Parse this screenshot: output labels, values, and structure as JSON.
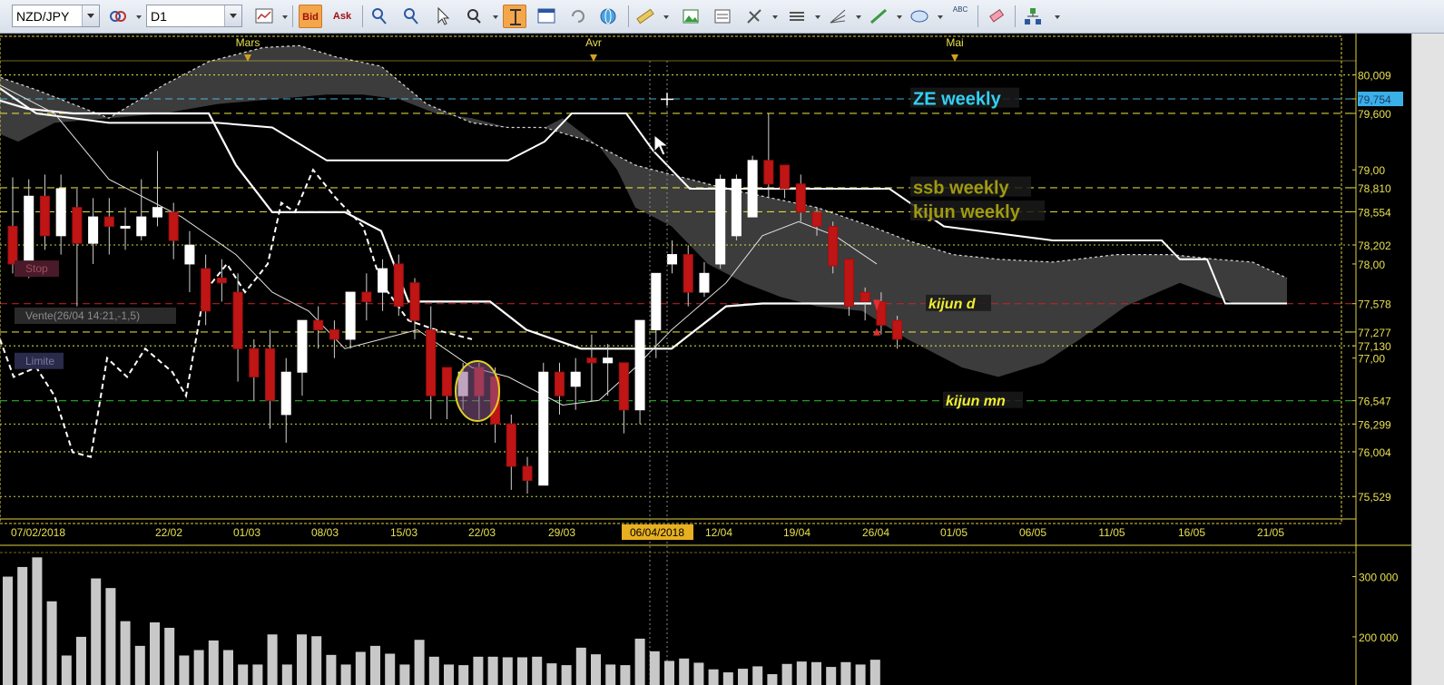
{
  "toolbar": {
    "symbol": "NZD/JPY",
    "timeframe": "D1",
    "bid_label": "Bid",
    "ask_label": "Ask",
    "abc_label": "ABC"
  },
  "chart_data": {
    "type": "candlestick",
    "instrument": "NZD/JPY",
    "timeframe": "D1",
    "months": [
      "Mars",
      "Avr",
      "Mai"
    ],
    "x_ticks": [
      "07/02/2018",
      "22/02",
      "01/03",
      "08/03",
      "15/03",
      "22/03",
      "29/03",
      "06/04/2018",
      "12/04",
      "19/04",
      "26/04",
      "01/05",
      "06/05",
      "11/05",
      "16/05",
      "21/05"
    ],
    "y_range": [
      75.3,
      80.4
    ],
    "y_ticks": [
      "80,009",
      "79,754",
      "79,600",
      "79,00",
      "78,810",
      "78,554",
      "78,202",
      "78,00",
      "77,578",
      "77,277",
      "77,130",
      "77,00",
      "76,547",
      "76,299",
      "76,004",
      "75,529"
    ],
    "level_lines": [
      {
        "value": 80.009,
        "color": "#e8e840",
        "style": "dotted"
      },
      {
        "value": 79.754,
        "color": "#4dc3f0",
        "style": "dashed"
      },
      {
        "value": 79.6,
        "color": "#e8e840",
        "style": "dashed"
      },
      {
        "value": 78.81,
        "color": "#e8e840",
        "style": "dashed"
      },
      {
        "value": 78.554,
        "color": "#e8e840",
        "style": "dashed"
      },
      {
        "value": 78.202,
        "color": "#e8e840",
        "style": "dotted"
      },
      {
        "value": 77.578,
        "color": "#cc2020",
        "style": "dashed"
      },
      {
        "value": 77.277,
        "color": "#e8e840",
        "style": "dashed"
      },
      {
        "value": 77.13,
        "color": "#e8e840",
        "style": "dotted"
      },
      {
        "value": 76.547,
        "color": "#30c030",
        "style": "dashed"
      },
      {
        "value": 76.299,
        "color": "#e8e840",
        "style": "dotted"
      },
      {
        "value": 76.004,
        "color": "#e8e840",
        "style": "dotted"
      },
      {
        "value": 75.529,
        "color": "#e8e840",
        "style": "dotted"
      }
    ],
    "annotations": [
      {
        "text": "ZE weekly",
        "color": "#33d0f5"
      },
      {
        "text": "ssb weekly",
        "color": "#a09a10"
      },
      {
        "text": "kijun weekly",
        "color": "#a09a10"
      },
      {
        "text": "kijun d",
        "color": "#f0ee30"
      },
      {
        "text": "kijun mn",
        "color": "#f0ee30"
      }
    ],
    "order_labels": [
      "Stop",
      "Vente(26/04 14:21,-1,5)",
      "Limite"
    ],
    "candles": [
      [
        78.4,
        78.0,
        78.92,
        77.9
      ],
      [
        78.0,
        78.72,
        78.9,
        77.85
      ],
      [
        78.72,
        78.3,
        78.95,
        78.15
      ],
      [
        78.3,
        78.8,
        78.95,
        78.1
      ],
      [
        78.6,
        78.22,
        78.8,
        77.55
      ],
      [
        78.22,
        78.5,
        78.7,
        78.0
      ],
      [
        78.5,
        78.4,
        78.7,
        78.1
      ],
      [
        78.4,
        78.4,
        78.6,
        78.15
      ],
      [
        78.3,
        78.5,
        78.9,
        78.25
      ],
      [
        78.5,
        78.6,
        79.2,
        78.4
      ],
      [
        78.55,
        78.25,
        78.65,
        78.05
      ],
      [
        78.0,
        78.2,
        78.35,
        77.7
      ],
      [
        77.95,
        77.5,
        78.1,
        77.35
      ],
      [
        77.85,
        77.8,
        78.05,
        77.6
      ],
      [
        77.7,
        77.1,
        77.9,
        76.75
      ],
      [
        77.1,
        76.8,
        77.2,
        76.55
      ],
      [
        77.1,
        76.55,
        77.3,
        76.25
      ],
      [
        76.4,
        76.85,
        77.0,
        76.1
      ],
      [
        76.85,
        77.4,
        77.4,
        76.6
      ],
      [
        77.4,
        77.3,
        77.55,
        77.1
      ],
      [
        77.3,
        77.2,
        77.4,
        77.0
      ],
      [
        77.2,
        77.7,
        77.7,
        77.1
      ],
      [
        77.7,
        77.6,
        77.9,
        77.4
      ],
      [
        77.7,
        77.95,
        78.05,
        77.5
      ],
      [
        78.0,
        77.55,
        78.1,
        77.45
      ],
      [
        77.8,
        77.4,
        77.85,
        77.2
      ],
      [
        77.3,
        76.6,
        77.55,
        76.35
      ],
      [
        76.9,
        76.6,
        76.9,
        76.35
      ],
      [
        76.6,
        76.85,
        76.95,
        76.45
      ],
      [
        76.9,
        76.6,
        76.95,
        76.35
      ],
      [
        76.8,
        76.3,
        76.9,
        76.1
      ],
      [
        76.3,
        75.85,
        76.4,
        75.6
      ],
      [
        75.85,
        75.7,
        75.95,
        75.56
      ],
      [
        75.65,
        76.85,
        76.95,
        75.65
      ],
      [
        76.85,
        76.6,
        76.95,
        76.4
      ],
      [
        76.7,
        76.85,
        77.0,
        76.45
      ],
      [
        77.0,
        76.95,
        77.25,
        76.55
      ],
      [
        76.95,
        77.0,
        77.15,
        76.6
      ],
      [
        76.95,
        76.45,
        76.95,
        76.2
      ],
      [
        76.45,
        77.4,
        77.4,
        76.3
      ],
      [
        77.3,
        77.9,
        77.9,
        77.0
      ],
      [
        78.0,
        78.1,
        78.25,
        77.9
      ],
      [
        78.1,
        77.7,
        78.2,
        77.55
      ],
      [
        77.7,
        77.9,
        78.02,
        77.65
      ],
      [
        78.0,
        78.9,
        78.95,
        77.95
      ],
      [
        78.3,
        78.9,
        78.95,
        78.25
      ],
      [
        78.5,
        79.1,
        79.15,
        78.5
      ],
      [
        79.1,
        78.85,
        79.6,
        78.7
      ],
      [
        79.05,
        78.8,
        79.05,
        78.7
      ],
      [
        78.85,
        78.55,
        78.95,
        78.45
      ],
      [
        78.55,
        78.4,
        78.6,
        78.3
      ],
      [
        78.4,
        77.98,
        78.45,
        77.9
      ],
      [
        78.05,
        77.55,
        78.05,
        77.45
      ],
      [
        77.7,
        77.6,
        77.75,
        77.4
      ],
      [
        77.6,
        77.35,
        77.7,
        77.25
      ],
      [
        77.4,
        77.2,
        77.45,
        77.1
      ]
    ],
    "volume_ticks": [
      "300 000",
      "200 000"
    ],
    "volume_range": [
      120000,
      340000
    ],
    "volume": [
      300000,
      316000,
      332000,
      259000,
      169000,
      200000,
      297000,
      281000,
      226000,
      185000,
      224000,
      215000,
      169000,
      178000,
      194000,
      178000,
      154000,
      154000,
      204000,
      154000,
      204000,
      201000,
      170000,
      154000,
      175000,
      185000,
      172000,
      154000,
      195000,
      167000,
      154000,
      153000,
      167000,
      167000,
      166000,
      166000,
      167000,
      156000,
      153000,
      182000,
      171000,
      154000,
      153000,
      197000,
      176000,
      160000,
      164000,
      157000,
      146000,
      141000,
      147000,
      151000,
      138000,
      155000,
      159000,
      158000,
      150000,
      158000,
      154000,
      162000
    ]
  }
}
